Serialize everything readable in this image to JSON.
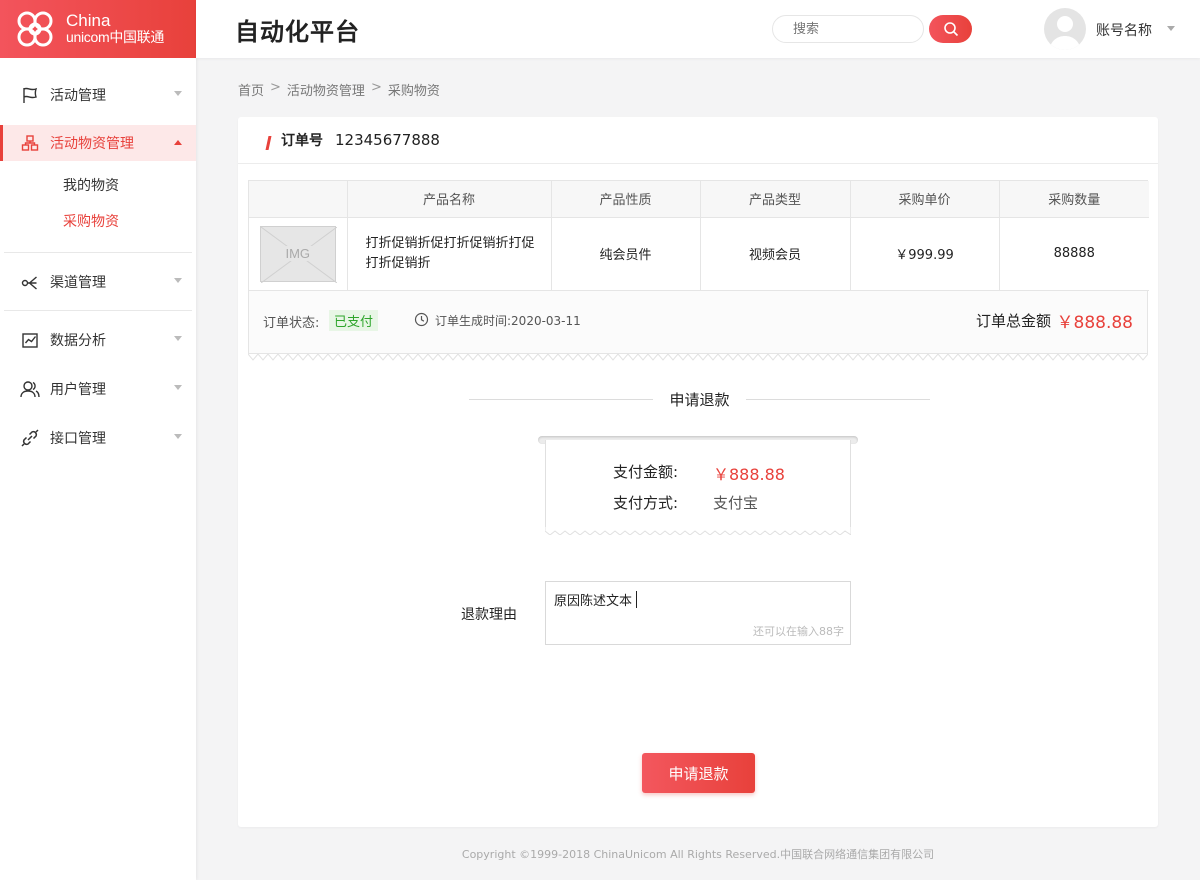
{
  "logo": {
    "line1": "China",
    "line2": "unicom中国联通"
  },
  "app_title": "自动化平台",
  "header": {
    "search_placeholder": "搜索",
    "account_name": "账号名称"
  },
  "sidebar": {
    "items": [
      {
        "label": "活动管理",
        "icon": "flag-icon"
      },
      {
        "label": "活动物资管理",
        "icon": "boxes-icon",
        "subitems": [
          "我的物资",
          "采购物资"
        ]
      },
      {
        "label": "渠道管理",
        "icon": "channel-icon"
      },
      {
        "label": "数据分析",
        "icon": "chart-icon"
      },
      {
        "label": "用户管理",
        "icon": "users-icon"
      },
      {
        "label": "接口管理",
        "icon": "link-icon"
      }
    ]
  },
  "breadcrumb": [
    "首页",
    "活动物资管理",
    "采购物资"
  ],
  "breadcrumb_sep": ">",
  "order": {
    "number_label": "订单号",
    "number": "12345677888",
    "columns": [
      "产品名称",
      "产品性质",
      "产品类型",
      "采购单价",
      "采购数量"
    ],
    "row": {
      "image_label": "IMG",
      "name": "打折促销折促打折促销折打促打折促销折",
      "nature": "纯会员件",
      "type": "视频会员",
      "price": "￥999.99",
      "quantity": "88888"
    },
    "status_label": "订单状态:",
    "status": "已支付",
    "time_label": "订单生成时间:2020-03-11",
    "total_label": "订单总金额",
    "total": "￥888.88"
  },
  "refund": {
    "title": "申请退款",
    "pay_amount_label": "支付金额:",
    "pay_amount": "￥888.88",
    "pay_method_label": "支付方式:",
    "pay_method": "支付宝",
    "reason_label": "退款理由",
    "reason_text": "原因陈述文本",
    "reason_hint": "还可以在输入88字",
    "submit_label": "申请退款"
  },
  "copyright": "Copyright ©1999-2018 ChinaUnicom All Rights Reserved.中国联合网络通信集团有限公司",
  "colors": {
    "brand": "#e8413b",
    "success": "#2ea52b"
  }
}
